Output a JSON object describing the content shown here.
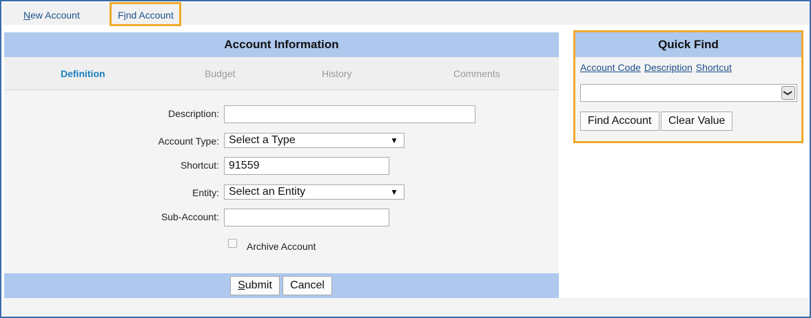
{
  "topnav": {
    "new_account_prefix": "N",
    "new_account_rest": "ew Account",
    "find_account_prefix": "F",
    "find_account_mid": "i",
    "find_account_rest": "nd Account"
  },
  "account_panel": {
    "title": "Account Information",
    "tabs": [
      {
        "label": "Definition",
        "active": true
      },
      {
        "label": "Budget",
        "active": false
      },
      {
        "label": "History",
        "active": false
      },
      {
        "label": "Comments",
        "active": false
      }
    ],
    "fields": {
      "description_label": "Description:",
      "description_value": "",
      "account_type_label": "Account Type:",
      "account_type_value": "Select a Type",
      "shortcut_label": "Shortcut:",
      "shortcut_value": "91559",
      "entity_label": "Entity:",
      "entity_value": "Select an Entity",
      "sub_account_label": "Sub-Account:",
      "sub_account_value": "",
      "archive_label": "Archive Account",
      "archive_checked": false
    },
    "submit_prefix": "S",
    "submit_rest": "ubmit",
    "cancel_label": "Cancel"
  },
  "quick_find": {
    "title": "Quick Find",
    "links": [
      "Account Code",
      "Description",
      "Shortcut"
    ],
    "select_value": "",
    "find_button": "Find Account",
    "clear_button": "Clear Value"
  },
  "colors": {
    "header_blue": "#aec8ee",
    "highlight_orange": "#f0a92b",
    "link_blue": "#1c4f8c",
    "active_tab": "#1a7fbf"
  }
}
